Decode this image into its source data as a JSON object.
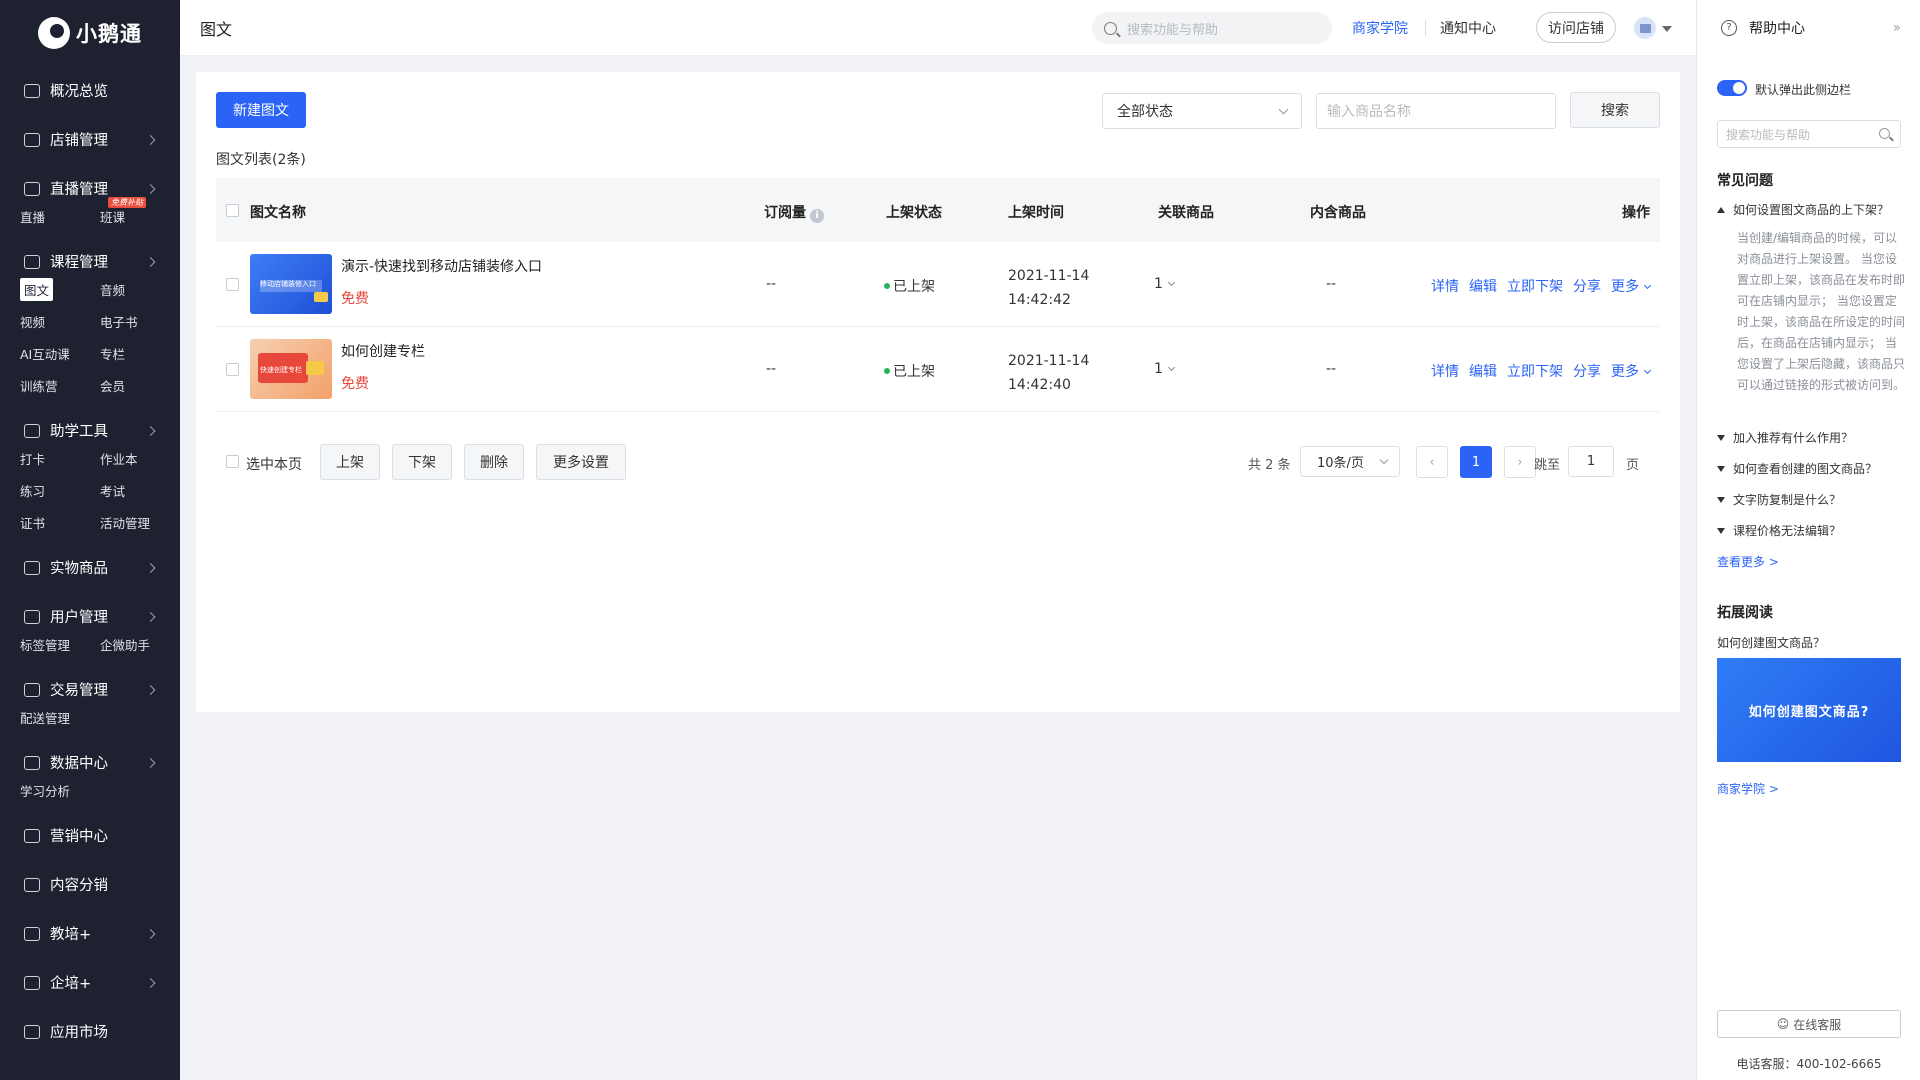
{
  "brand": {
    "name": "小鹅通"
  },
  "sidebar": {
    "sections": [
      {
        "label": "概况总览",
        "subs": []
      },
      {
        "label": "店铺管理",
        "subs": []
      },
      {
        "label": "直播管理",
        "subs": [
          "直播",
          "班课"
        ]
      },
      {
        "label": "课程管理",
        "subs": [
          "图文",
          "音频",
          "视频",
          "电子书",
          "AI互动课",
          "专栏",
          "训练营",
          "会员"
        ]
      },
      {
        "label": "助学工具",
        "subs": [
          "打卡",
          "作业本",
          "练习",
          "考试",
          "证书",
          "活动管理"
        ]
      },
      {
        "label": "实物商品",
        "subs": []
      },
      {
        "label": "用户管理",
        "subs": [
          "标签管理",
          "企微助手"
        ]
      },
      {
        "label": "交易管理",
        "subs": [
          "配送管理"
        ]
      },
      {
        "label": "数据中心",
        "subs": [
          "学习分析"
        ]
      },
      {
        "label": "营销中心",
        "subs": []
      },
      {
        "label": "内容分销",
        "subs": []
      },
      {
        "label": "教培+",
        "subs": []
      },
      {
        "label": "企培+",
        "subs": []
      },
      {
        "label": "应用市场",
        "subs": []
      }
    ],
    "badge": "免费补贴",
    "active_sub": "图文"
  },
  "topbar": {
    "title": "图文",
    "search_placeholder": "搜索功能与帮助",
    "academy": "商家学院",
    "notice": "通知中心",
    "visit_store": "访问店铺"
  },
  "toolbar": {
    "new_button": "新建图文",
    "status_select": "全部状态",
    "name_placeholder": "输入商品名称",
    "search_button": "搜索"
  },
  "list": {
    "title": "图文列表(2条)",
    "columns": {
      "name": "图文名称",
      "subscriptions": "订阅量",
      "status": "上架状态",
      "time": "上架时间",
      "related": "关联商品",
      "included": "内含商品",
      "ops": "操作"
    },
    "rows": [
      {
        "name": "演示-快速找到移动店铺装修入口",
        "price": "免费",
        "subs": "--",
        "status": "已上架",
        "date": "2021-11-14",
        "time": "14:42:42",
        "related": "1",
        "included": "--"
      },
      {
        "name": "如何创建专栏",
        "price": "免费",
        "subs": "--",
        "status": "已上架",
        "date": "2021-11-14",
        "time": "14:42:40",
        "related": "1",
        "included": "--"
      }
    ],
    "ops": {
      "detail": "详情",
      "edit": "编辑",
      "offshelf": "立即下架",
      "share": "分享",
      "more": "更多"
    },
    "thumb1_text": "移动店铺装修入口",
    "thumb2_text": "快速创建专栏"
  },
  "footer": {
    "select_page": "选中本页",
    "on_shelf": "上架",
    "off_shelf": "下架",
    "delete": "删除",
    "more_settings": "更多设置",
    "total": "共 2 条",
    "page_size": "10条/页",
    "current_page": "1",
    "jump_to": "跳至",
    "jump_value": "1",
    "page_unit": "页"
  },
  "help": {
    "title": "帮助中心",
    "toggle_label": "默认弹出此侧边栏",
    "search_placeholder": "搜索功能与帮助",
    "faq_title": "常见问题",
    "faqs": [
      "如何设置图文商品的上下架？",
      "加入推荐有什么作用？",
      "如何查看创建的图文商品？",
      "文字防复制是什么？",
      "课程价格无法编辑？"
    ],
    "faq_answer": "当创建/编辑商品的时候，可以对商品进行上架设置。 当您设置立即上架，该商品在发布时即可在店铺内显示； 当您设置定时上架，该商品在所设定的时间后，在商品在店铺内显示； 当您设置了上架后隐藏，该商品只可以通过链接的形式被访问到。",
    "more_link": "查看更多 >",
    "reading_title": "拓展阅读",
    "reading_item": "如何创建图文商品？",
    "banner_text": "如何创建图文商品?",
    "academy_link": "商家学院 >",
    "online_service": "在线客服",
    "phone": "电话客服：400-102-6665"
  },
  "colors": {
    "accent": "#2b63f6",
    "sidebar_bg": "#1e2230",
    "free": "#e9473b",
    "published_dot": "#27b35a"
  }
}
